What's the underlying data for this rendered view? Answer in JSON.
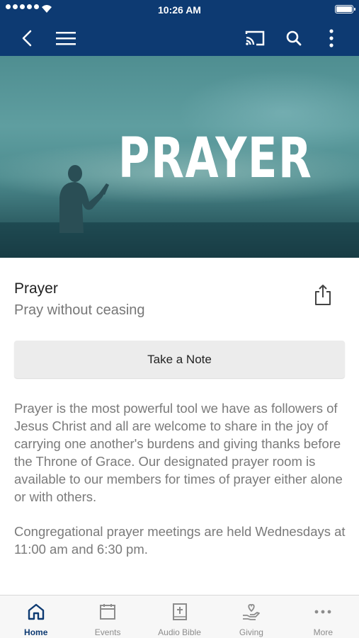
{
  "status_bar": {
    "time": "10:26 AM"
  },
  "hero": {
    "title": "PRAYER"
  },
  "page": {
    "heading": "Prayer",
    "subheading": "Pray without ceasing",
    "note_button_label": "Take a Note",
    "paragraphs": [
      "Prayer is the most powerful tool we have as followers of Jesus Christ and all are welcome to share in the joy of carrying one another's burdens and giving thanks before the Throne of Grace. Our designated prayer room is available to our members for times of prayer either alone or with others.",
      "Congregational prayer meetings are held Wednesdays at 11:00 am and 6:30 pm."
    ]
  },
  "tabs": [
    {
      "label": "Home",
      "icon": "home-icon",
      "active": true
    },
    {
      "label": "Events",
      "icon": "calendar-icon",
      "active": false
    },
    {
      "label": "Audio Bible",
      "icon": "bible-icon",
      "active": false
    },
    {
      "label": "Giving",
      "icon": "giving-icon",
      "active": false
    },
    {
      "label": "More",
      "icon": "more-icon",
      "active": false
    }
  ],
  "colors": {
    "nav": "#0d3a72",
    "active_tab": "#0d3a72",
    "inactive_tab": "#8c8c8c"
  }
}
